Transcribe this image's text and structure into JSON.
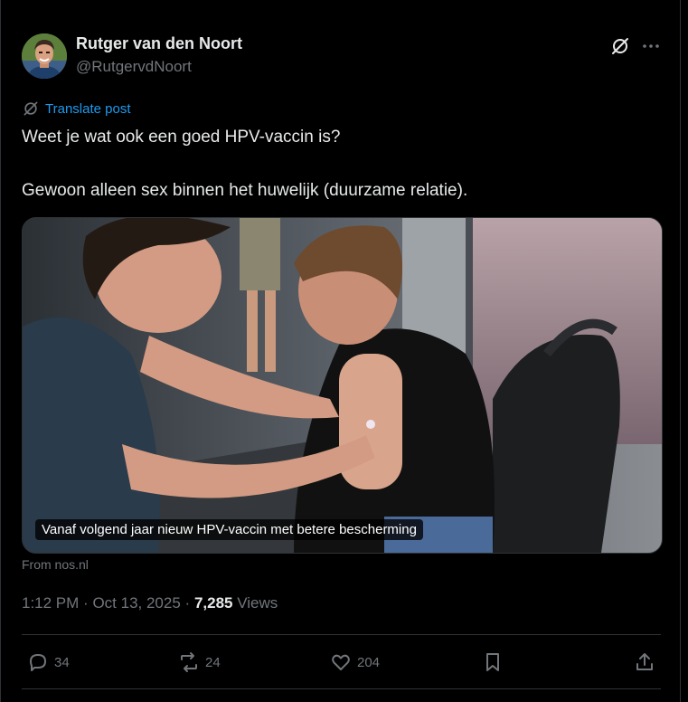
{
  "author": {
    "display_name": "Rutger van den Noort",
    "handle": "@RutgervdNoort"
  },
  "header_icons": {
    "grok": "grok-icon",
    "more": "more-dots-icon"
  },
  "translate": {
    "label": "Translate post",
    "icon": "translate-icon"
  },
  "post": {
    "line1": "Weet je wat ook een goed HPV-vaccin is?",
    "line2": "Gewoon alleen sex binnen het huwelijk (duurzame relatie)."
  },
  "link_card": {
    "headline": "Vanaf volgend jaar nieuw HPV-vaccin met betere bescherming",
    "source": "From nos.nl"
  },
  "meta": {
    "time": "1:12 PM",
    "separator": "·",
    "date": "Oct 13, 2025",
    "views_count": "7,285",
    "views_label": "Views"
  },
  "actions": {
    "replies": "34",
    "reposts": "24",
    "likes": "204"
  },
  "colors": {
    "background": "#000000",
    "text": "#e7e9ea",
    "muted": "#71767b",
    "accent": "#1d9bf0",
    "border": "#2f3336"
  }
}
